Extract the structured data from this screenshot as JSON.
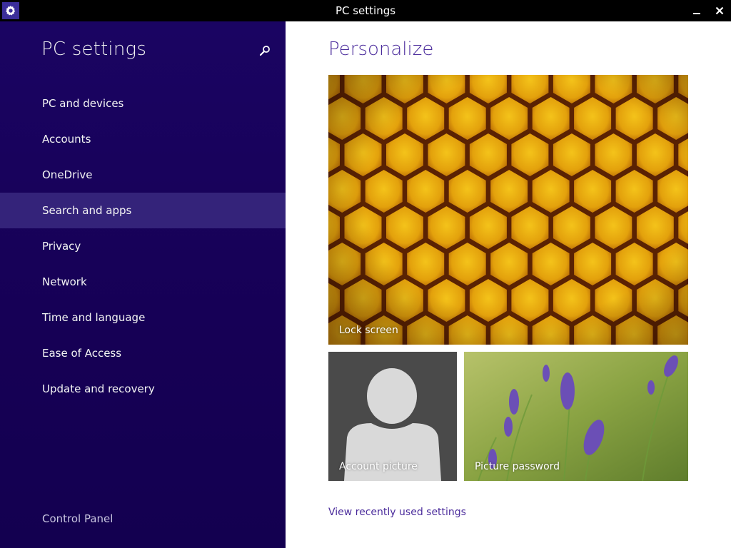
{
  "window": {
    "title": "PC settings",
    "icon": "gear-icon",
    "controls": [
      "minimize-icon",
      "close-icon"
    ]
  },
  "sidebar": {
    "heading": "PC settings",
    "search_icon": "search-icon",
    "items": [
      {
        "label": "PC and devices",
        "selected": false
      },
      {
        "label": "Accounts",
        "selected": false
      },
      {
        "label": "OneDrive",
        "selected": false
      },
      {
        "label": "Search and apps",
        "selected": true
      },
      {
        "label": "Privacy",
        "selected": false
      },
      {
        "label": "Network",
        "selected": false
      },
      {
        "label": "Time and language",
        "selected": false
      },
      {
        "label": "Ease of Access",
        "selected": false
      },
      {
        "label": "Update and recovery",
        "selected": false
      }
    ],
    "footer_link": "Control Panel"
  },
  "main": {
    "title": "Personalize",
    "tiles": {
      "lock_screen": "Lock screen",
      "account_picture": "Account picture",
      "picture_password": "Picture password"
    },
    "recent_link": "View recently used settings"
  },
  "colors": {
    "sidebar_bg": "#18005a",
    "selected_bg": "#34237a",
    "accent_text": "#4b2c9c",
    "titlebar_bg": "#000000"
  }
}
